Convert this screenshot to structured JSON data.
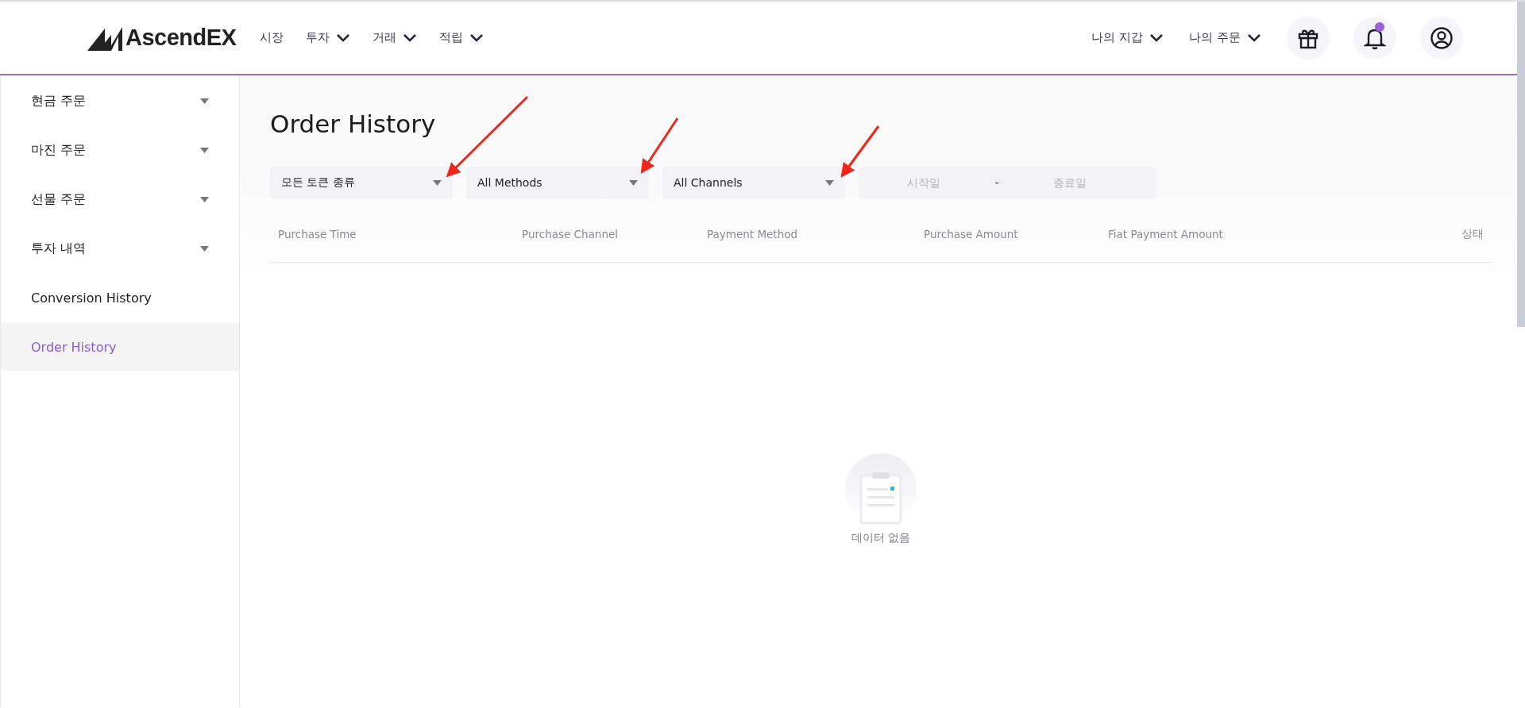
{
  "header": {
    "logo": "AscendEX",
    "nav": [
      {
        "label": "시장",
        "dropdown": false
      },
      {
        "label": "투자",
        "dropdown": true
      },
      {
        "label": "거래",
        "dropdown": true
      },
      {
        "label": "적립",
        "dropdown": true
      }
    ],
    "account_menus": [
      {
        "label": "나의 지갑"
      },
      {
        "label": "나의 주문"
      }
    ],
    "notification_unread": true
  },
  "sidebar": {
    "items": [
      {
        "label": "현금 주문",
        "expandable": true,
        "selected": false
      },
      {
        "label": "마진 주문",
        "expandable": true,
        "selected": false
      },
      {
        "label": "선물 주문",
        "expandable": true,
        "selected": false
      },
      {
        "label": "투자 내역",
        "expandable": true,
        "selected": false
      },
      {
        "label": "Conversion History",
        "expandable": false,
        "selected": false
      },
      {
        "label": "Order History",
        "expandable": false,
        "selected": true
      }
    ]
  },
  "page": {
    "title": "Order History",
    "filters": [
      {
        "value": "모든 토큰 종류"
      },
      {
        "value": "All Methods"
      },
      {
        "value": "All Channels"
      }
    ],
    "date_range": {
      "start_placeholder": "시작일",
      "separator": "-",
      "end_placeholder": "종료일"
    },
    "table": {
      "columns": [
        "Purchase Time",
        "Purchase Channel",
        "Payment Method",
        "Purchase Amount",
        "Fiat Payment Amount",
        "상태"
      ]
    },
    "empty_text": "데이터 없음"
  }
}
